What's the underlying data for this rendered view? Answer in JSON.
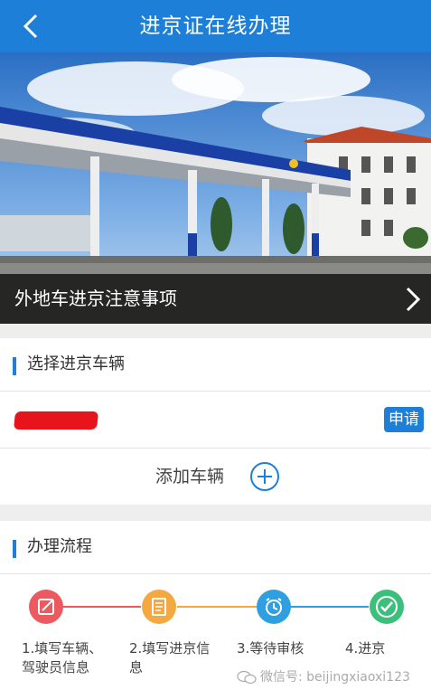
{
  "header": {
    "title": "进京证在线办理",
    "back_icon": "back-chevron-icon"
  },
  "banner": {
    "notice_text": "外地车进京注意事项",
    "chevron_icon": "chevron-right-icon"
  },
  "vehicle_section": {
    "title": "选择进京车辆",
    "apply_label": "申请",
    "add_label": "添加车辆",
    "add_icon": "plus-circle-icon"
  },
  "process_section": {
    "title": "办理流程",
    "steps": [
      {
        "label": "1.填写车辆、驾驶员信息",
        "color": "#ea5a5f",
        "icon": "edit-icon"
      },
      {
        "label": "2.填写进京信息",
        "color": "#f4a842",
        "icon": "document-icon"
      },
      {
        "label": "3.等待审核",
        "color": "#2f9fe0",
        "icon": "alarm-clock-icon"
      },
      {
        "label": "4.进京",
        "color": "#3cbf7a",
        "icon": "checkmark-icon"
      }
    ]
  },
  "watermark": {
    "text": "微信号: beijingxiaoxi123"
  },
  "colors": {
    "accent": "#1e7fd8",
    "background": "#eeeeee"
  }
}
